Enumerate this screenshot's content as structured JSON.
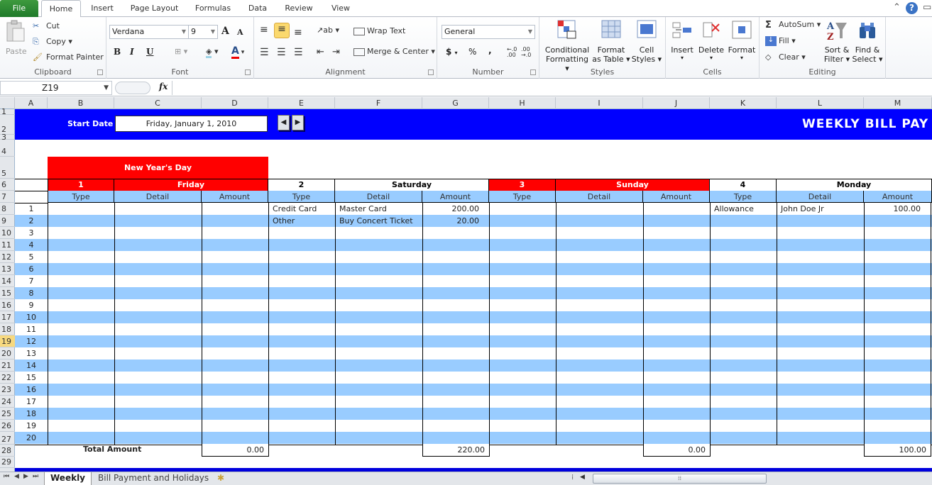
{
  "ribbon": {
    "tabs": [
      "File",
      "Home",
      "Insert",
      "Page Layout",
      "Formulas",
      "Data",
      "Review",
      "View"
    ],
    "active_tab": "Home",
    "clipboard": {
      "paste": "Paste",
      "cut": "Cut",
      "copy": "Copy",
      "format_painter": "Format Painter",
      "label": "Clipboard"
    },
    "font": {
      "name": "Verdana",
      "size": "9",
      "bold": "B",
      "italic": "I",
      "underline": "U",
      "label": "Font",
      "grow": "A",
      "shrink": "A",
      "font_color": "A"
    },
    "alignment": {
      "wrap_text": "Wrap Text",
      "merge_center": "Merge & Center",
      "label": "Alignment"
    },
    "number": {
      "format": "General",
      "currency": "$",
      "percent": "%",
      "comma": ",",
      "inc_decimal": ".0→.00",
      "dec_decimal": ".00→.0",
      "label": "Number"
    },
    "styles": {
      "conditional_1": "Conditional",
      "conditional_2": "Formatting",
      "format_table_1": "Format",
      "format_table_2": "as Table",
      "cell_styles_1": "Cell",
      "cell_styles_2": "Styles",
      "label": "Styles"
    },
    "cells": {
      "insert": "Insert",
      "delete": "Delete",
      "format": "Format",
      "label": "Cells"
    },
    "editing": {
      "autosum": "AutoSum",
      "fill": "Fill",
      "clear": "Clear",
      "sort_1": "Sort &",
      "sort_2": "Filter",
      "find_1": "Find &",
      "find_2": "Select",
      "label": "Editing",
      "sigma": "Σ"
    }
  },
  "formula_bar": {
    "name_box": "Z19",
    "fx": "fx",
    "formula": ""
  },
  "columns": [
    "A",
    "B",
    "C",
    "D",
    "E",
    "F",
    "G",
    "H",
    "I",
    "J",
    "K",
    "L",
    "M"
  ],
  "row_numbers": [
    "1",
    "2",
    "3",
    "4",
    "5",
    "6",
    "7",
    "8",
    "9",
    "10",
    "11",
    "12",
    "13",
    "14",
    "15",
    "16",
    "17",
    "18",
    "19",
    "20",
    "21",
    "22",
    "23",
    "24",
    "25",
    "26",
    "27",
    "28",
    "29"
  ],
  "selected_row": "19",
  "sheet": {
    "start_date_label": "Start Date :",
    "start_date": "Friday, January 1, 2010",
    "prev_glyph": "◀",
    "next_glyph": "▶",
    "title": "WEEKLY BILL PAY",
    "holiday": "New Year's Day",
    "days": [
      {
        "num": "1",
        "name": "Friday",
        "highlight": true
      },
      {
        "num": "2",
        "name": "Saturday",
        "highlight": false
      },
      {
        "num": "3",
        "name": "Sunday",
        "highlight": true
      },
      {
        "num": "4",
        "name": "Monday",
        "highlight": false
      }
    ],
    "sub_headers": {
      "type": "Type",
      "detail": "Detail",
      "amount": "Amount"
    },
    "entry_numbers": [
      "1",
      "2",
      "3",
      "4",
      "5",
      "6",
      "7",
      "8",
      "9",
      "10",
      "11",
      "12",
      "13",
      "14",
      "15",
      "16",
      "17",
      "18",
      "19",
      "20"
    ],
    "entries": {
      "friday": [],
      "saturday": [
        {
          "type": "Credit Card",
          "detail": "Master Card",
          "amount": "200.00"
        },
        {
          "type": "Other",
          "detail": "Buy Concert Ticket",
          "amount": "20.00"
        }
      ],
      "sunday": [],
      "monday": [
        {
          "type": "Allowance",
          "detail": "John Doe Jr",
          "amount": "100.00"
        }
      ]
    },
    "total_label": "Total Amount",
    "totals": [
      "0.00",
      "220.00",
      "0.00",
      "100.00"
    ],
    "colors": {
      "banner": "#0000ff",
      "holiday": "#ff0000",
      "stripe": "#99ccff"
    }
  },
  "sheet_tabs": {
    "tabs": [
      "Weekly",
      "Bill Payment and Holidays"
    ],
    "active": "Weekly"
  },
  "nav": {
    "first": "⏮",
    "prev": "◀",
    "next": "▶",
    "last": "⏭"
  }
}
